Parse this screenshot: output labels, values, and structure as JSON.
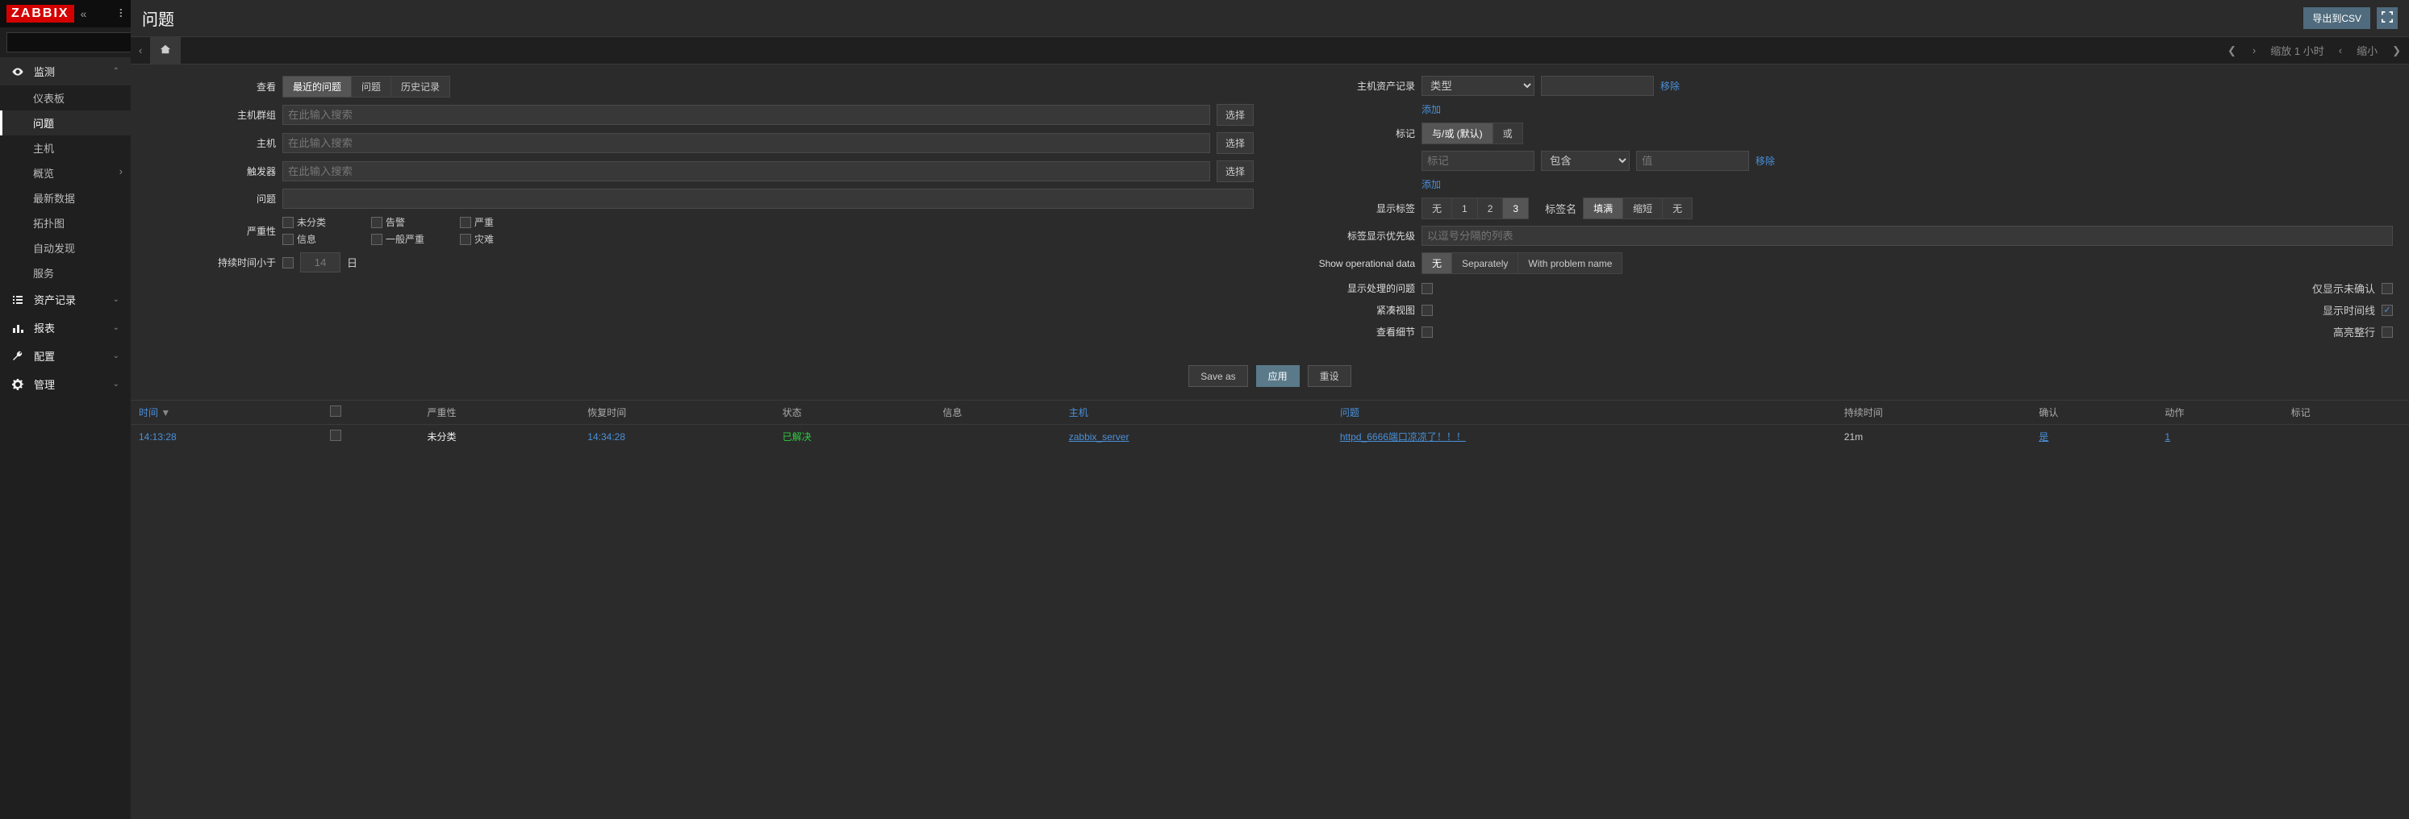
{
  "brand": "ZABBIX",
  "search": {
    "placeholder": ""
  },
  "nav": {
    "monitor": {
      "label": "监测",
      "items": [
        "仪表板",
        "问题",
        "主机",
        "概览",
        "最新数据",
        "拓扑图",
        "自动发现",
        "服务"
      ],
      "activeIndex": 1,
      "chevIndex": 3
    },
    "sections": [
      {
        "icon": "list",
        "label": "资产记录"
      },
      {
        "icon": "bar",
        "label": "报表"
      },
      {
        "icon": "wrench",
        "label": "配置"
      },
      {
        "icon": "gear",
        "label": "管理"
      }
    ]
  },
  "page": {
    "title": "问题"
  },
  "toolbar": {
    "export_csv": "导出到CSV"
  },
  "breadcrumb": {
    "zoom_label": "缩放 1 小时",
    "shrink": "缩小"
  },
  "filter": {
    "left": {
      "view_label": "查看",
      "view_opts": [
        "最近的问题",
        "问题",
        "历史记录"
      ],
      "hostgroup_label": "主机群组",
      "host_label": "主机",
      "trigger_label": "触发器",
      "problem_label": "问题",
      "severity_label": "严重性",
      "sev_opts": [
        [
          "未分类",
          "告警",
          "严重"
        ],
        [
          "信息",
          "一般严重",
          "灾难"
        ]
      ],
      "duration_label": "持续时间小于",
      "duration_value": "14",
      "duration_unit": "日",
      "search_placeholder": "在此输入搜索",
      "select_btn": "选择"
    },
    "right": {
      "asset_label": "主机资产记录",
      "asset_type": "类型",
      "remove": "移除",
      "add": "添加",
      "tag_label": "标记",
      "tag_andor": "与/或 (默认)",
      "tag_or": "或",
      "tag_placeholder": "标记",
      "tag_op": "包含",
      "tag_value_placeholder": "值",
      "showtags_label": "显示标签",
      "showtags_opts": [
        "无",
        "1",
        "2",
        "3"
      ],
      "tagname_label": "标签名",
      "tagname_opts": [
        "填满",
        "缩短",
        "无"
      ],
      "tagprio_label": "标签显示优先级",
      "tagprio_placeholder": "以逗号分隔的列表",
      "opdata_label": "Show operational data",
      "opdata_opts": [
        "无",
        "Separately",
        "With problem name"
      ],
      "chk1l": "显示处理的问题",
      "chk1r": "仅显示未确认",
      "chk2l": "紧凑视图",
      "chk2r": "显示时间线",
      "chk3l": "查看细节",
      "chk3r": "高亮整行"
    },
    "actions": {
      "save_as": "Save as",
      "apply": "应用",
      "reset": "重设"
    }
  },
  "table": {
    "columns": [
      "时间",
      "",
      "严重性",
      "恢复时间",
      "状态",
      "信息",
      "主机",
      "问题",
      "持续时间",
      "确认",
      "动作",
      "标记"
    ],
    "rows": [
      {
        "time": "14:13:28",
        "severity": "未分类",
        "recovery": "14:34:28",
        "status": "已解决",
        "host": "zabbix_server",
        "problem": "httpd_6666端口凉凉了！！！",
        "duration": "21m",
        "ack": "是",
        "actions": "1"
      }
    ]
  }
}
